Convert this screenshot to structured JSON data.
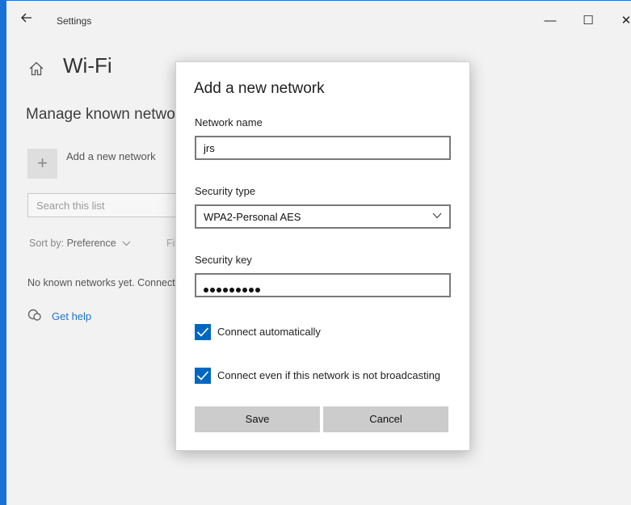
{
  "window": {
    "app_title": "Settings",
    "controls": {
      "minimize": "—",
      "maximize": "☐",
      "close": "✕"
    }
  },
  "page": {
    "title": "Wi-Fi",
    "section_title": "Manage known networks",
    "add_network_label": "Add a new network",
    "search_placeholder": "Search this list",
    "sort_label": "Sort by:",
    "sort_value": "Preference",
    "filter_label": "Fi",
    "empty_message": "No known networks yet. Connect to a network",
    "help_link": "Get help"
  },
  "dialog": {
    "title": "Add a new network",
    "network_name_label": "Network name",
    "network_name_value": "jrs",
    "security_type_label": "Security type",
    "security_type_value": "WPA2-Personal AES",
    "security_key_label": "Security key",
    "security_key_masked_length": 9,
    "connect_auto_label": "Connect automatically",
    "connect_auto_checked": true,
    "connect_hidden_label": "Connect even if this network is not broadcasting",
    "connect_hidden_checked": true,
    "save_label": "Save",
    "cancel_label": "Cancel"
  },
  "colors": {
    "accent": "#0067c0",
    "window_border": "#1a73d4",
    "link": "#1a73d4",
    "button_bg": "#cccccc"
  }
}
